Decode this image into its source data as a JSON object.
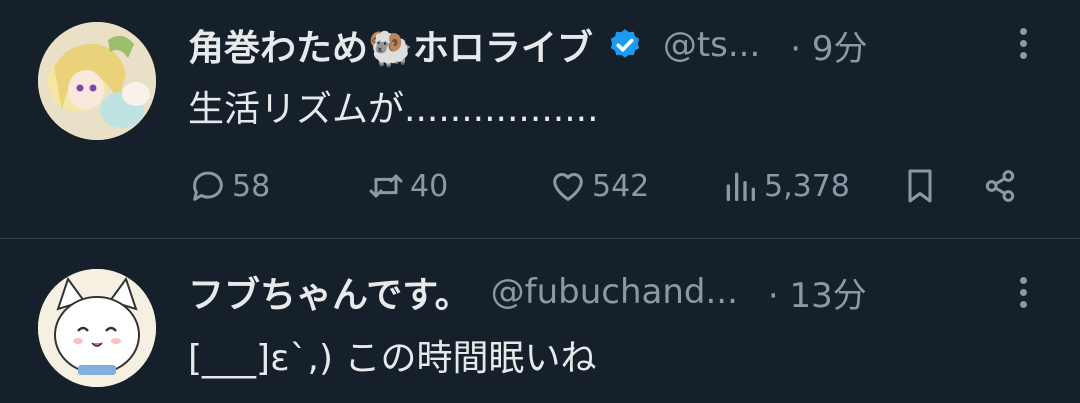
{
  "tweets": [
    {
      "name": "角巻わため🐏ホロライブ",
      "handle": "@ts...",
      "time": "· 9分",
      "text": "生活リズムが.................",
      "replies": "58",
      "retweets": "40",
      "likes": "542",
      "views": "5,378"
    },
    {
      "name": "フブちゃんです。",
      "handle": "@fubuchand...",
      "time": "· 13分",
      "text": "[___]ε`,) この時間眠いね"
    }
  ],
  "colors": {
    "background": "#15202b",
    "text": "#e7e9ea",
    "muted": "#8b98a5",
    "verified": "#1d9bf0",
    "divider": "#38444d"
  },
  "icons": [
    "more-icon",
    "verified-icon",
    "reply-icon",
    "retweet-icon",
    "like-icon",
    "views-icon",
    "bookmark-icon",
    "share-icon"
  ]
}
